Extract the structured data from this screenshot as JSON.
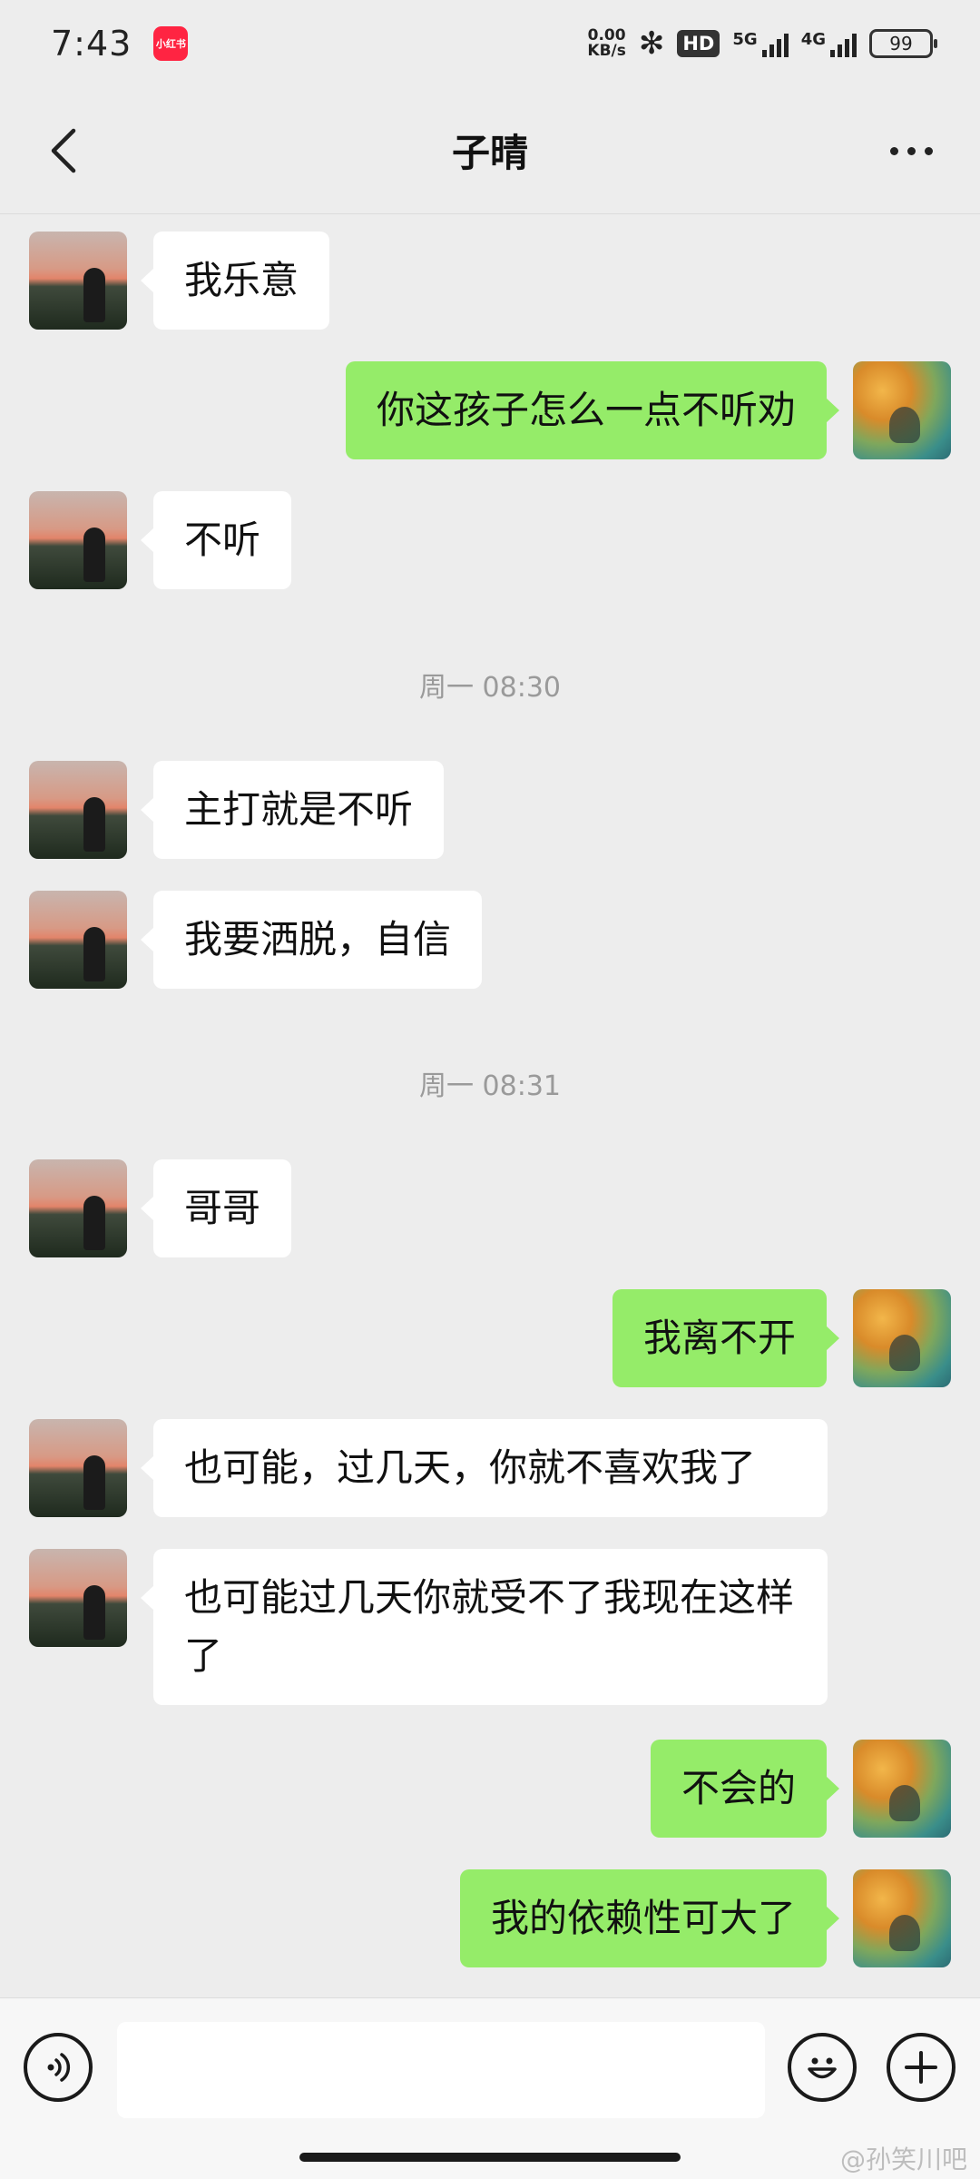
{
  "status_bar": {
    "time": "7:43",
    "app_icon_label": "小红书",
    "net_speed_value": "0.00",
    "net_speed_unit": "KB/s",
    "hd_label": "HD",
    "network_1": "5G",
    "network_2": "4G",
    "battery": "99"
  },
  "header": {
    "title": "子晴"
  },
  "messages": [
    {
      "side": "left",
      "text": "我乐意"
    },
    {
      "side": "right",
      "text": "你这孩子怎么一点不听劝"
    },
    {
      "side": "left",
      "text": "不听"
    },
    {
      "type": "time",
      "text": "周一 08:30"
    },
    {
      "side": "left",
      "text": "主打就是不听"
    },
    {
      "side": "left",
      "text": "我要洒脱，自信"
    },
    {
      "type": "time",
      "text": "周一 08:31"
    },
    {
      "side": "left",
      "text": "哥哥"
    },
    {
      "side": "right",
      "text": "我离不开"
    },
    {
      "side": "left",
      "text": "也可能，过几天，你就不喜欢我了"
    },
    {
      "side": "left",
      "text": "也可能过几天你就受不了我现在这样了"
    },
    {
      "side": "right",
      "text": "不会的"
    },
    {
      "side": "right",
      "text": "我的依赖性可大了"
    }
  ],
  "input_bar": {
    "input_value": ""
  },
  "watermark": "@孙笑川吧",
  "colors": {
    "background": "#ededed",
    "own_bubble": "#95ec69",
    "other_bubble": "#ffffff"
  }
}
